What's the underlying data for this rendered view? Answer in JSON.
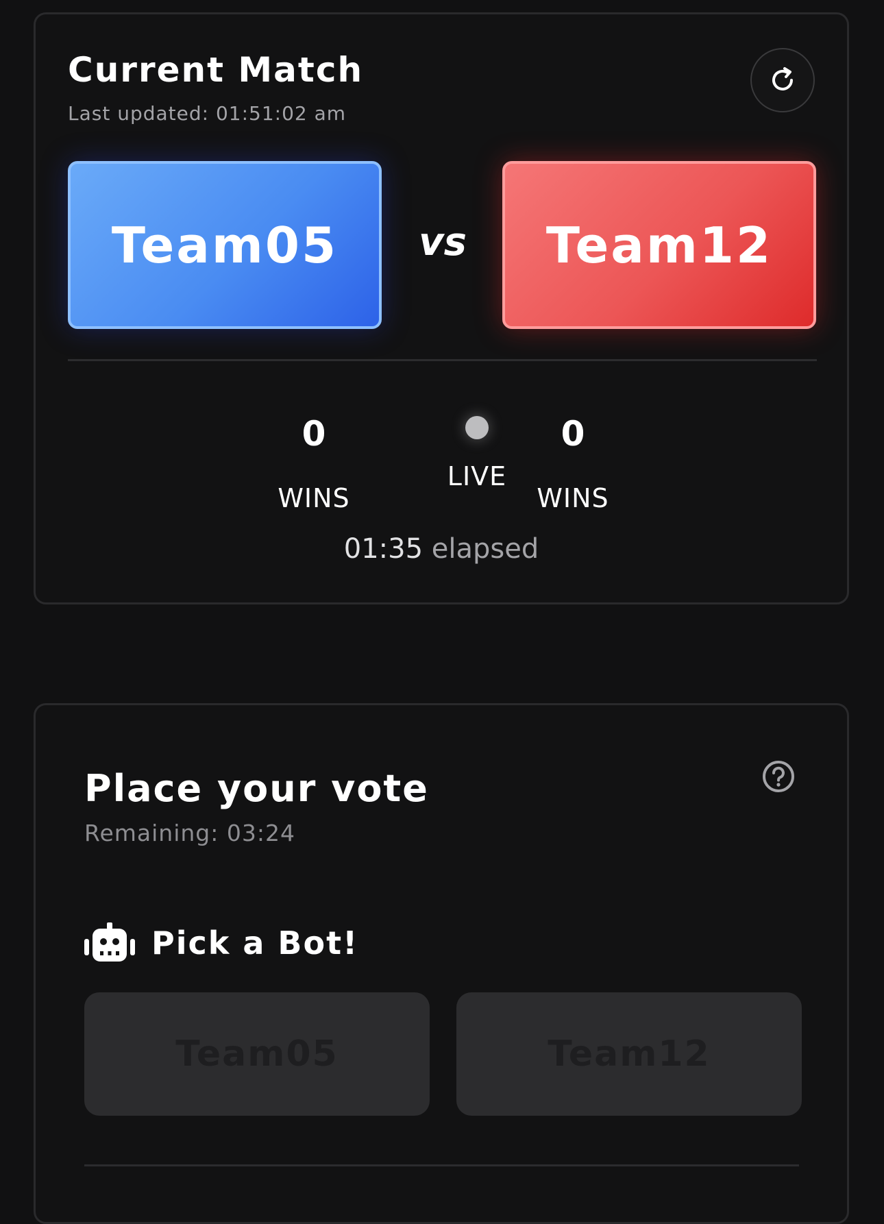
{
  "match": {
    "title": "Current Match",
    "last_updated": "Last updated: 01:51:02 am",
    "refresh_icon": "refresh-icon",
    "team_a": {
      "name": "Team05",
      "wins": "0",
      "wins_label": "WINS",
      "color": "#4a8cf2"
    },
    "team_b": {
      "name": "Team12",
      "wins": "0",
      "wins_label": "WINS",
      "color": "#ec5656"
    },
    "vs_label": "vs",
    "status": "LIVE",
    "elapsed_time": "01:35",
    "elapsed_word": "elapsed"
  },
  "vote": {
    "title": "Place your vote",
    "remaining": "Remaining: 03:24",
    "help_icon": "help-icon",
    "pick_icon": "robot-icon",
    "pick_label": "Pick a Bot!",
    "options": [
      "Team05",
      "Team12"
    ]
  }
}
